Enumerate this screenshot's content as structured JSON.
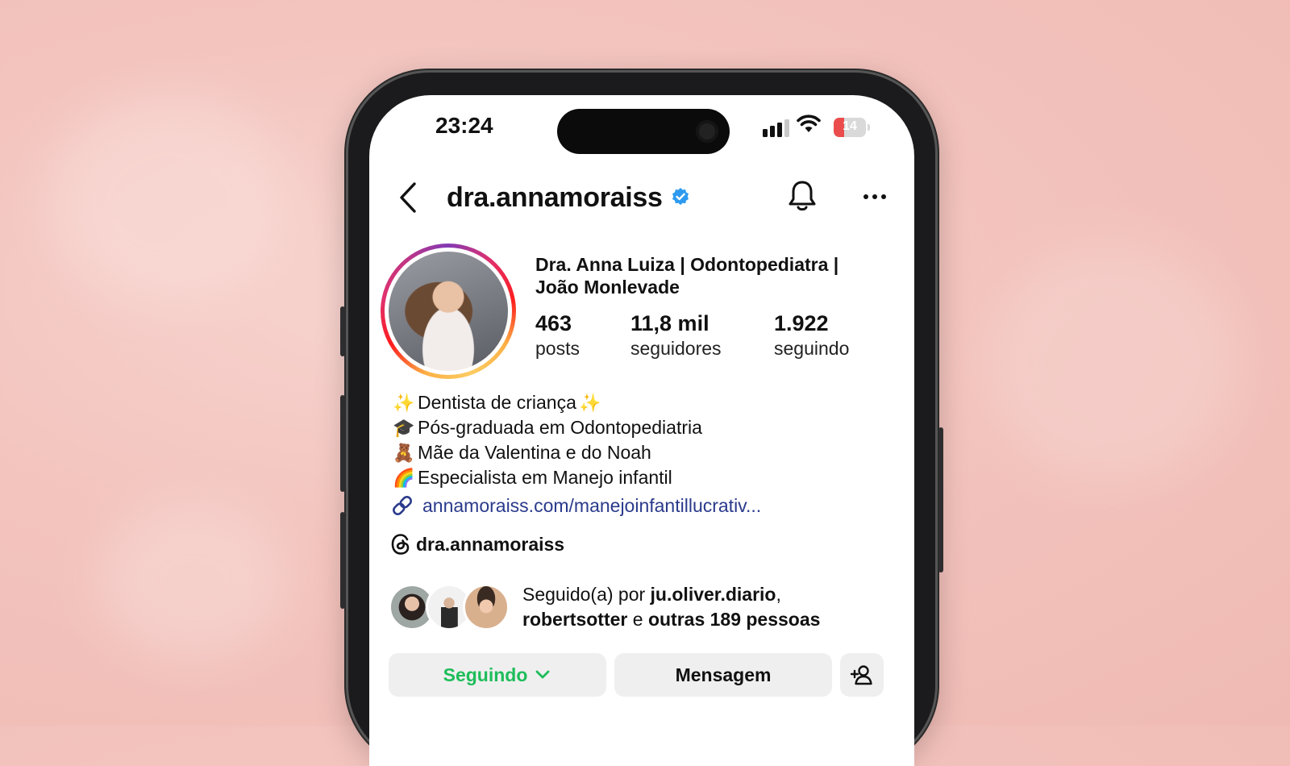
{
  "status_bar": {
    "time": "23:24",
    "battery": "14",
    "battery_level": 0.14
  },
  "header": {
    "username": "dra.annamoraiss",
    "verified": true
  },
  "profile": {
    "full_name_line1": "Dra. Anna Luiza | Odontopediatra |",
    "full_name_line2": "João Monlevade",
    "stats": [
      {
        "value": "463",
        "label": "posts"
      },
      {
        "value": "11,8 mil",
        "label": "seguidores"
      },
      {
        "value": "1.922",
        "label": "seguindo"
      }
    ]
  },
  "bio": {
    "lines": [
      {
        "emoji": "✨",
        "text": "Dentista de criança",
        "trail": "✨"
      },
      {
        "emoji": "🎓",
        "text": "Pós-graduada em Odontopediatria"
      },
      {
        "emoji": "🧸",
        "text": "Mãe da Valentina e do Noah"
      },
      {
        "emoji": "🌈",
        "text": "Especialista em Manejo infantil"
      }
    ],
    "link": "annamoraiss.com/manejoinfantillucrativ...",
    "threads_handle": "dra.annamoraiss"
  },
  "followed_by": {
    "prefix": "Seguido(a) por ",
    "user1": "ju.oliver.diario",
    "comma": ",",
    "user2": "robertsotter",
    "connector": " e ",
    "others": "outras 189 pessoas"
  },
  "actions": {
    "following_label": "Seguindo",
    "message_label": "Mensagem"
  },
  "icons": [
    "back-chevron-icon",
    "verified-badge-icon",
    "bell-icon",
    "more-icon",
    "link-icon",
    "threads-icon",
    "chevron-down-icon",
    "add-person-icon",
    "signal-icon",
    "wifi-icon"
  ],
  "colors": {
    "accent_green": "#1ebd5a",
    "link_blue": "#2a3a8c",
    "verified_blue": "#2e9bf0",
    "button_bg": "#efefef"
  }
}
